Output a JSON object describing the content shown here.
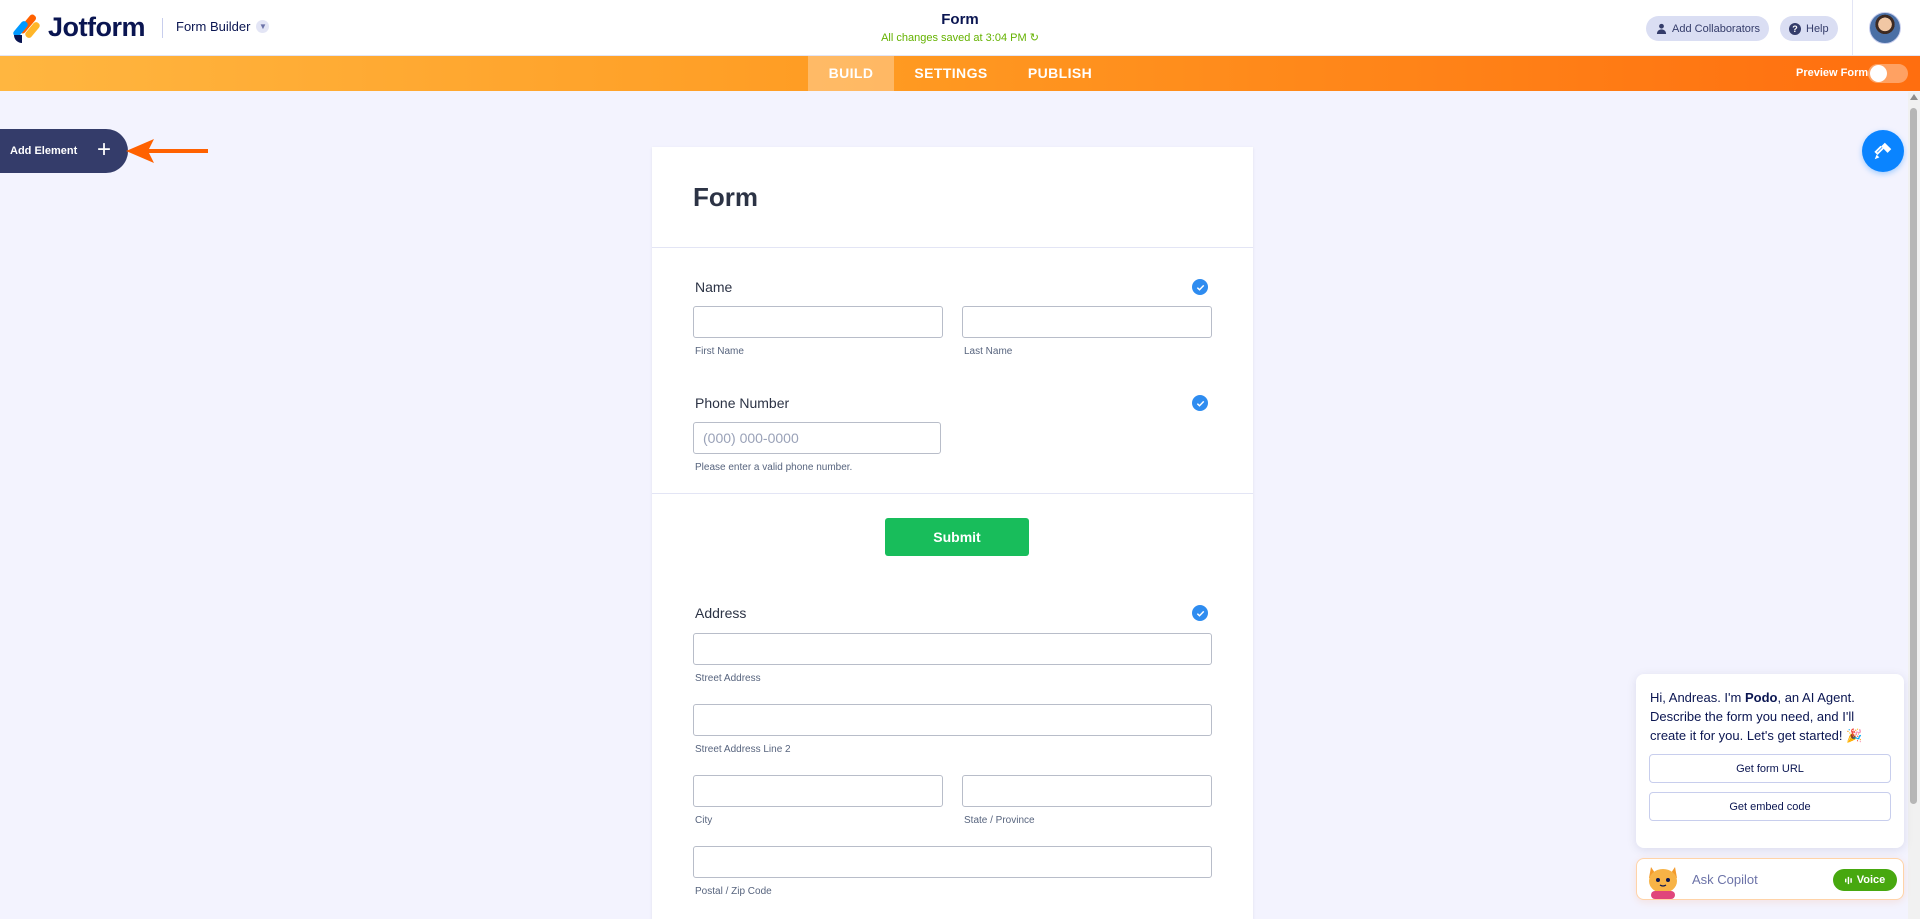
{
  "header": {
    "brand": "Jotform",
    "builder_menu": "Form Builder",
    "form_title": "Form",
    "saved_status": "All changes saved at 3:04 PM",
    "add_collaborators": "Add Collaborators",
    "help": "Help"
  },
  "nav": {
    "tabs": [
      {
        "label": "BUILD",
        "active": true
      },
      {
        "label": "SETTINGS",
        "active": false
      },
      {
        "label": "PUBLISH",
        "active": false
      }
    ],
    "preview_label": "Preview Form"
  },
  "sidebar": {
    "add_element": "Add Element"
  },
  "form": {
    "title": "Form",
    "name": {
      "label": "Name",
      "first_sub": "First Name",
      "last_sub": "Last Name"
    },
    "phone": {
      "label": "Phone Number",
      "placeholder": "(000) 000-0000",
      "sub": "Please enter a valid phone number."
    },
    "submit_label": "Submit",
    "address": {
      "label": "Address",
      "street_sub": "Street Address",
      "street2_sub": "Street Address Line 2",
      "city_sub": "City",
      "state_sub": "State / Province",
      "postal_sub": "Postal / Zip Code"
    }
  },
  "copilot": {
    "greeting_pre": "Hi, Andreas. I'm ",
    "agent_name": "Podo",
    "greeting_post": ", an AI Agent. Describe the form you need, and I'll create it for you. Let's get started! 🎉",
    "buttons": [
      "Get form URL",
      "Get embed code"
    ],
    "ask_placeholder": "Ask Copilot",
    "voice_label": "Voice"
  },
  "colors": {
    "brand_navy": "#0a1551",
    "nav_orange_start": "#ffb640",
    "nav_orange_end": "#ff6e0f",
    "check_blue": "#2e8cf0",
    "submit_green": "#18bd5b",
    "saved_green": "#64b200"
  }
}
